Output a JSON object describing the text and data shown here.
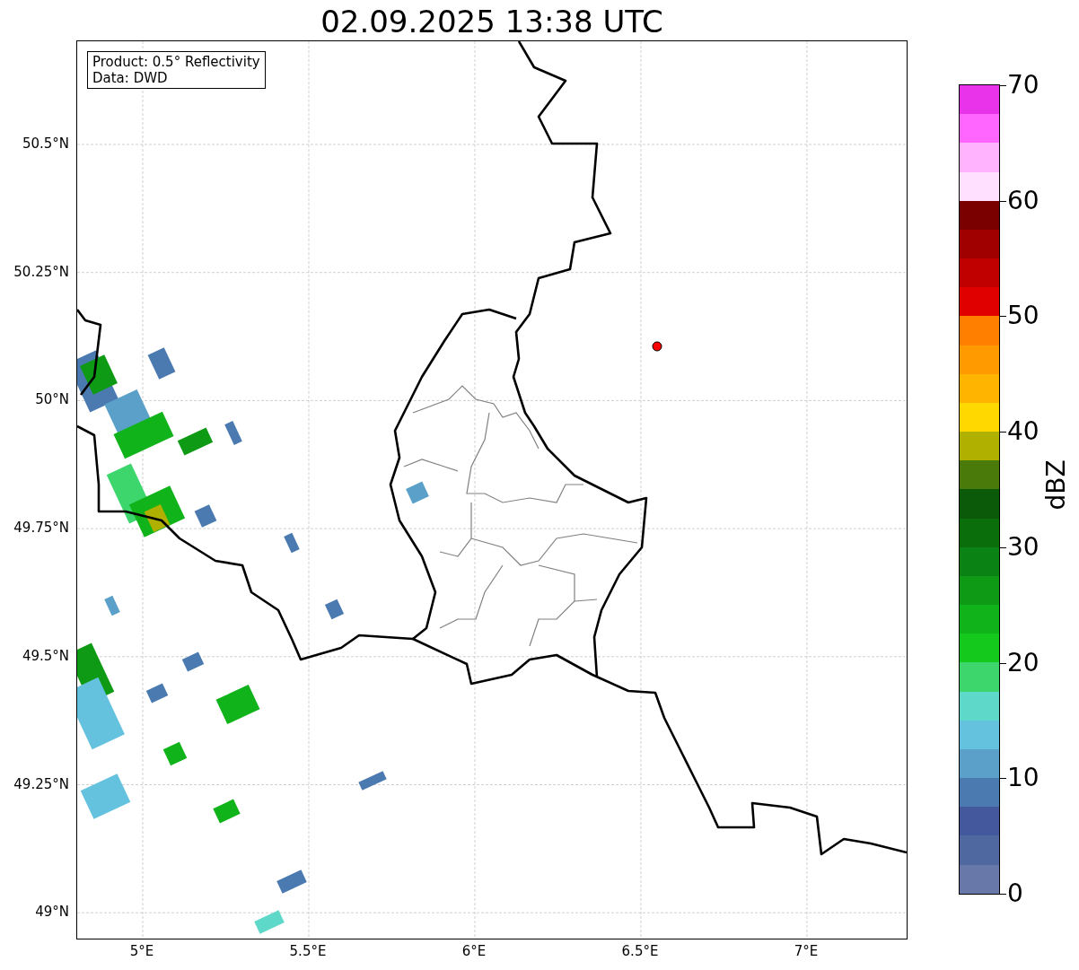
{
  "title": "02.09.2025 13:38 UTC",
  "info_box": [
    "Product: 0.5° Reflectivity",
    "Data: DWD"
  ],
  "lat_labels": [
    "50.5°N",
    "50.25°N",
    "50°N",
    "49.75°N",
    "49.5°N",
    "49.25°N",
    "49°N"
  ],
  "lon_labels": [
    "5°E",
    "5.5°E",
    "6°E",
    "6.5°E",
    "7°E"
  ],
  "colorbar": {
    "label": "dBZ",
    "ticks": [
      "70",
      "60",
      "50",
      "40",
      "30",
      "20",
      "10",
      "0"
    ],
    "bands": [
      {
        "color": "#e933ea"
      },
      {
        "color": "#ff66ff"
      },
      {
        "color": "#ffb3ff"
      },
      {
        "color": "#ffe0ff"
      },
      {
        "color": "#7a0000"
      },
      {
        "color": "#a00000"
      },
      {
        "color": "#c00000"
      },
      {
        "color": "#e00000"
      },
      {
        "color": "#ff7f00"
      },
      {
        "color": "#ff9a00"
      },
      {
        "color": "#ffb400"
      },
      {
        "color": "#ffd800"
      },
      {
        "color": "#b0b000"
      },
      {
        "color": "#4a7a0a"
      },
      {
        "color": "#0a5a0a"
      },
      {
        "color": "#0a6e0a"
      },
      {
        "color": "#0a8214"
      },
      {
        "color": "#0e9a14"
      },
      {
        "color": "#10b41a"
      },
      {
        "color": "#14c81c"
      },
      {
        "color": "#3cd66c"
      },
      {
        "color": "#5ed8c8"
      },
      {
        "color": "#64c2de"
      },
      {
        "color": "#5aa0c8"
      },
      {
        "color": "#4a7ab0"
      },
      {
        "color": "#44589e"
      },
      {
        "color": "#5068a0"
      },
      {
        "color": "#6878a8"
      }
    ]
  }
}
